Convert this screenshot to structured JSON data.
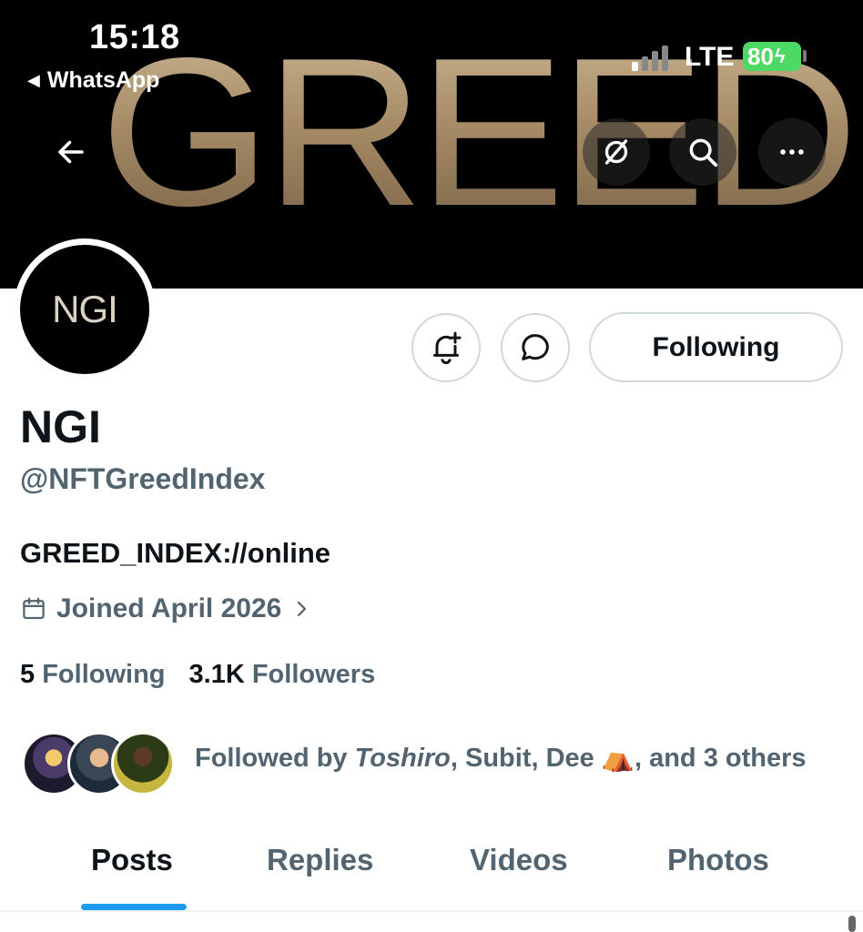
{
  "status_bar": {
    "time": "15:18",
    "back_app": "WhatsApp",
    "network": "LTE",
    "battery": "80"
  },
  "banner": {
    "text": "GREED"
  },
  "header_nav": {
    "back_icon": "arrow-left-icon",
    "translate_icon": "translate-icon",
    "search_icon": "search-icon",
    "more_icon": "more-icon"
  },
  "profile": {
    "avatar_text": "NGI",
    "display_name": "NGI",
    "handle": "@NFTGreedIndex",
    "bio": "GREED_INDEX://online",
    "joined": "Joined April 2026",
    "following_count": "5",
    "following_label": "Following",
    "followers_count": "3.1K",
    "followers_label": "Followers"
  },
  "actions": {
    "follow_button": "Following"
  },
  "followed_by": {
    "prefix": "Followed by ",
    "name1": "Toshiro",
    "rest": ", Subit, Dee ⛺, and 3 others"
  },
  "tabs": [
    {
      "label": "Posts",
      "active": true
    },
    {
      "label": "Replies",
      "active": false
    },
    {
      "label": "Videos",
      "active": false
    },
    {
      "label": "Photos",
      "active": false
    }
  ],
  "colors": {
    "accent": "#1d9bf0",
    "secondary_text": "#536471",
    "primary_text": "#0f1419",
    "banner_gold": "#b39b76"
  }
}
